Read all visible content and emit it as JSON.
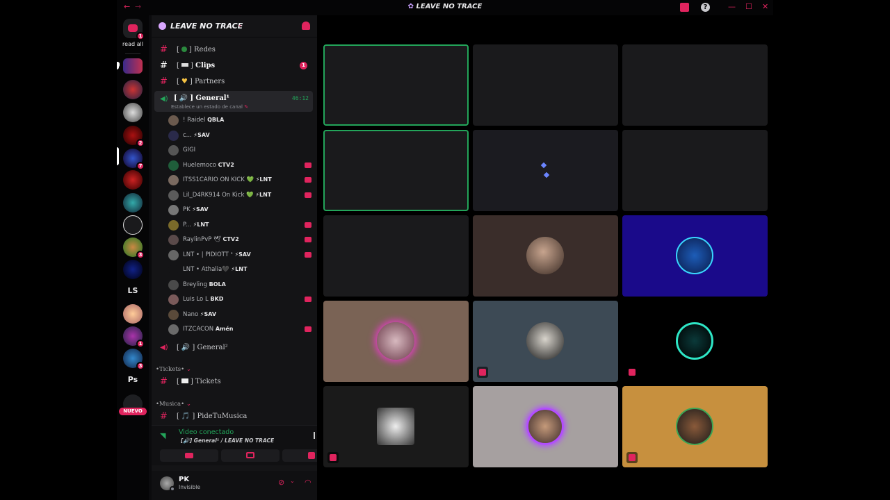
{
  "window": {
    "title": "LEAVE NO TRACE",
    "back_glyph": "←",
    "forward_glyph": "→",
    "inbox_icon": "inbox-icon",
    "help_glyph": "?",
    "minimize_glyph": "—",
    "maximize_glyph": "☐",
    "close_glyph": "✕"
  },
  "guilds": {
    "read_all_label": "read all",
    "dm_badge": "1",
    "badges": [
      "2",
      "7",
      "3",
      "1",
      "3"
    ],
    "text_servers": [
      "LS",
      "Ps"
    ],
    "new_label": "NUEVO"
  },
  "server": {
    "name": "LEAVE NO TRACE"
  },
  "channels": {
    "redes": "Redes",
    "clips": "Clips",
    "clips_badge": "1",
    "partners": "Partners",
    "general1": "General¹",
    "general1_time": "46:12",
    "status_prompt": "Establece un estado de canal",
    "general2": "General²",
    "tickets_category": "•Tickets•",
    "tickets": "Tickets",
    "musica_category": "•Musica•",
    "pidetumusica": "PideTuMusica"
  },
  "voice_users": [
    {
      "name": "! Raidel",
      "tag": "QBLA",
      "color": "#6b5a4e"
    },
    {
      "name": "c...",
      "tag": "⚡SAV",
      "color": "#2a2a4a"
    },
    {
      "name": "GIGI",
      "tag": "",
      "color": "#555"
    },
    {
      "name": "Huelemoco",
      "tag": "CTV2",
      "color": "#1f5d3a"
    },
    {
      "name": "ITSS1CARIO ON KICK 💚",
      "tag": "⚡LNT",
      "color": "#7a6a60"
    },
    {
      "name": "Lil_D4RK914 On Kick 💚",
      "tag": "⚡LNT",
      "color": "#5b5b5b"
    },
    {
      "name": "PK",
      "tag": "⚡SAV",
      "color": "#777"
    },
    {
      "name": "P...",
      "tag": "⚡LNT",
      "color": "#7a6a2a"
    },
    {
      "name": "RaylinPvP 🕊",
      "tag": "CTV2",
      "color": "#5a4a4a"
    },
    {
      "name": "LNT • | PIDIOTT ˢ",
      "tag": "⚡SAV",
      "color": "#666"
    },
    {
      "name": "LNT • Athalia🖤",
      "tag": "⚡LNT",
      "color": "#141416"
    },
    {
      "name": "Breyling",
      "tag": "BOLA",
      "color": "#4a4a4a"
    },
    {
      "name": "Luis Lo L",
      "tag": "BKD",
      "color": "#7a5a5a"
    },
    {
      "name": "Nano",
      "tag": "⚡SAV",
      "color": "#5a4a3a"
    },
    {
      "name": "ITZCACON",
      "tag": "Amén",
      "color": "#6a6a6a"
    }
  ],
  "voice_panel": {
    "status": "Video conectado",
    "channel_line": "[🔊] General¹ / LEAVE NO TRACE"
  },
  "user_panel": {
    "name": "PK",
    "status": "Invisible"
  },
  "colors": {
    "accent": "#e0245e",
    "speaking": "#23a55a",
    "background": "#0b0b0d"
  }
}
